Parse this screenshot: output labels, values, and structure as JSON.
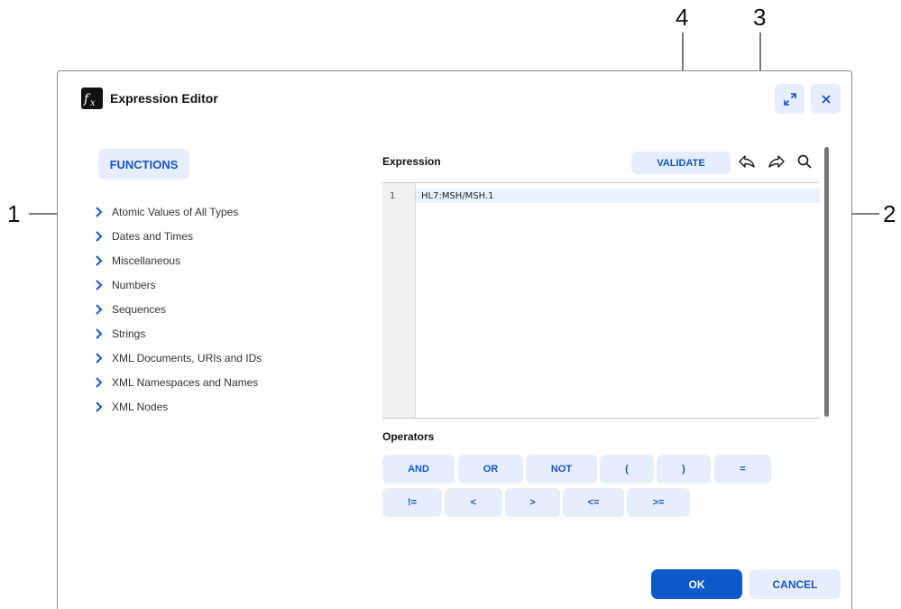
{
  "dialog": {
    "title": "Expression Editor",
    "logo_icon": "fx-icon"
  },
  "header_buttons": {
    "expand_icon": "expand-icon",
    "close_icon": "close-icon"
  },
  "functions": {
    "label": "FUNCTIONS",
    "items": [
      {
        "label": "Atomic Values of All Types"
      },
      {
        "label": "Dates and Times"
      },
      {
        "label": "Miscellaneous"
      },
      {
        "label": "Numbers"
      },
      {
        "label": "Sequences"
      },
      {
        "label": "Strings"
      },
      {
        "label": "XML Documents, URIs and IDs"
      },
      {
        "label": "XML Namespaces and Names"
      },
      {
        "label": "XML Nodes"
      }
    ]
  },
  "expression": {
    "label": "Expression",
    "validate_label": "VALIDATE",
    "lines": [
      {
        "number": "1",
        "text": "HL7:MSH/MSH.1"
      }
    ]
  },
  "operators": {
    "label": "Operators",
    "row1": [
      "AND",
      "OR",
      "NOT",
      "(",
      ")",
      "="
    ],
    "row2": [
      "!=",
      "<",
      ">",
      "<=",
      ">="
    ]
  },
  "footer": {
    "ok_label": "OK",
    "cancel_label": "CANCEL"
  },
  "callouts": {
    "c1": "1",
    "c2": "2",
    "c3": "3",
    "c4": "4"
  },
  "colors": {
    "accent": "#1656c9",
    "primary_button": "#0c5ac9",
    "soft_button": "#e6eefb"
  }
}
